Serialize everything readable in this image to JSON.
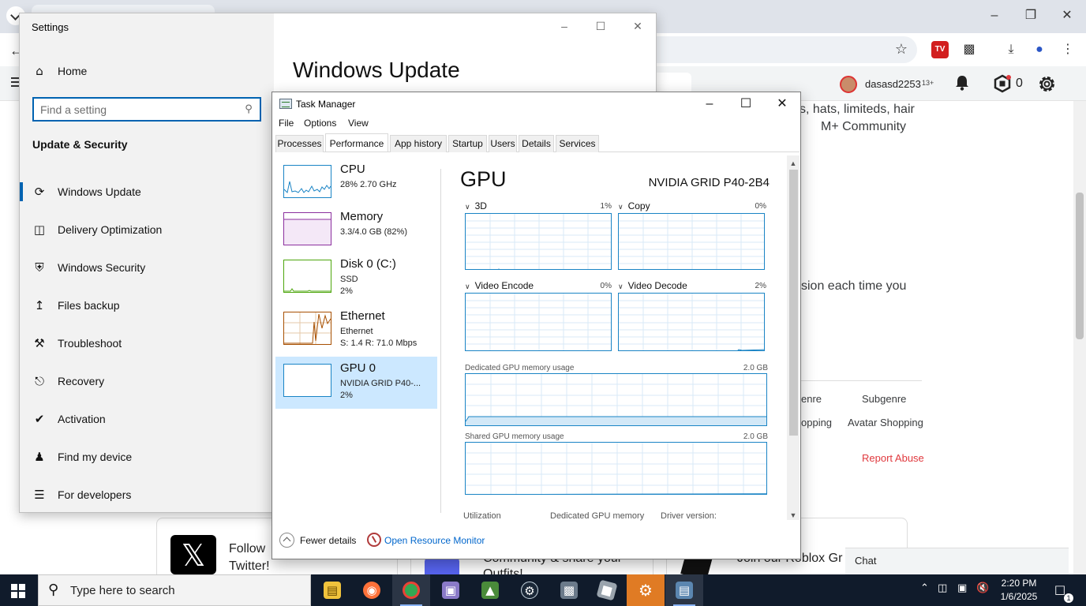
{
  "browser": {
    "username": "dasasd2253",
    "age_tag": "13+",
    "robux_count": "0",
    "text_line1": "s, hats, limiteds, hair",
    "text_line2": "M+ Community",
    "text_line3": "sion each time you",
    "genre_label": "enre",
    "subgenre_label": "Subgenre",
    "genre_value": "opping",
    "subgenre_value": "Avatar Shopping",
    "report_abuse": "Report Abuse",
    "card_x_title": "Follow",
    "card_x_title2": "Twitter!",
    "card_discord_text": "Community & share your",
    "card_discord_text2": "Outfits!",
    "card_roblox_text": "Join our Roblox Gr",
    "chat_label": "Chat"
  },
  "settings": {
    "window_title": "Settings",
    "home_label": "Home",
    "search_placeholder": "Find a setting",
    "section_title": "Update & Security",
    "page_heading": "Windows Update",
    "nav_items": [
      {
        "label": "Windows Update",
        "icon": "refresh-icon"
      },
      {
        "label": "Delivery Optimization",
        "icon": "delivery-icon"
      },
      {
        "label": "Windows Security",
        "icon": "shield-icon"
      },
      {
        "label": "Files backup",
        "icon": "upload-arrow-icon"
      },
      {
        "label": "Troubleshoot",
        "icon": "wrench-icon"
      },
      {
        "label": "Recovery",
        "icon": "recovery-icon"
      },
      {
        "label": "Activation",
        "icon": "check-circle-icon"
      },
      {
        "label": "Find my device",
        "icon": "person-location-icon"
      },
      {
        "label": "For developers",
        "icon": "developer-sliders-icon"
      }
    ]
  },
  "task_manager": {
    "window_title": "Task Manager",
    "menu": [
      "File",
      "Options",
      "View"
    ],
    "tabs": [
      "Processes",
      "Performance",
      "App history",
      "Startup",
      "Users",
      "Details",
      "Services"
    ],
    "active_tab": "Performance",
    "perf_list": [
      {
        "name": "CPU",
        "line1": "28%  2.70 GHz",
        "line2": "",
        "color": "#1a84c5"
      },
      {
        "name": "Memory",
        "line1": "3.3/4.0 GB (82%)",
        "line2": "",
        "color": "#8b2f9e"
      },
      {
        "name": "Disk 0 (C:)",
        "line1": "SSD",
        "line2": "2%",
        "color": "#4da60c"
      },
      {
        "name": "Ethernet",
        "line1": "Ethernet",
        "line2": "S: 1.4  R: 71.0 Mbps",
        "color": "#a74f01"
      },
      {
        "name": "GPU 0",
        "line1": "NVIDIA GRID P40-...",
        "line2": "2%",
        "color": "#1a84c5"
      }
    ],
    "gpu": {
      "title": "GPU",
      "model": "NVIDIA GRID P40-2B4",
      "engines": [
        {
          "label": "3D",
          "percent": "1%"
        },
        {
          "label": "Copy",
          "percent": "0%"
        },
        {
          "label": "Video Encode",
          "percent": "0%"
        },
        {
          "label": "Video Decode",
          "percent": "2%"
        }
      ],
      "dedicated_label": "Dedicated GPU memory usage",
      "dedicated_max": "2.0 GB",
      "shared_label": "Shared GPU memory usage",
      "shared_max": "2.0 GB",
      "stat_utilization": "Utilization",
      "stat_dedicated": "Dedicated GPU memory",
      "stat_driver": "Driver version:"
    },
    "fewer_details": "Fewer details",
    "open_resource_monitor": "Open Resource Monitor"
  },
  "taskbar": {
    "search_text": "Type here to search",
    "apps": [
      {
        "name": "file-explorer-icon",
        "color": "#f0c33c"
      },
      {
        "name": "firefox-icon",
        "color": "#ff7139"
      },
      {
        "name": "chrome-icon",
        "color": "#34a853"
      },
      {
        "name": "app-store-icon",
        "color": "#8a7ac8"
      },
      {
        "name": "image-viewer-icon",
        "color": "#4a8b3a"
      },
      {
        "name": "steam-icon",
        "color": "#1b2838"
      },
      {
        "name": "network-icon",
        "color": "#6b7a8a"
      },
      {
        "name": "roblox-icon",
        "color": "#9aa4ad"
      },
      {
        "name": "settings-gear-icon",
        "color": "#e07b24"
      },
      {
        "name": "task-manager-icon",
        "color": "#5b86b0"
      }
    ],
    "time": "2:20 PM",
    "date": "1/6/2025",
    "notification_count": "1"
  }
}
